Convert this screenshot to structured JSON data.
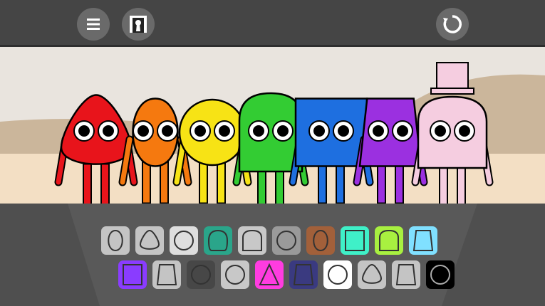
{
  "topbar": {
    "buttons": [
      {
        "icon": "menu-icon"
      },
      {
        "icon": "keyhole-portrait-icon"
      },
      {
        "icon": "reset-icon"
      }
    ]
  },
  "scene": {
    "sky_color": "#e9e4de",
    "ground_color": "#f3dfc4",
    "hill_color": "#cbb69b",
    "characters": [
      {
        "color": "#e8141b",
        "shape": "drop"
      },
      {
        "color": "#f5790f",
        "shape": "egg"
      },
      {
        "color": "#f7e315",
        "shape": "circle"
      },
      {
        "color": "#33cc33",
        "shape": "tombstone"
      },
      {
        "color": "#1e6fe0",
        "shape": "square"
      },
      {
        "color": "#9b30e0",
        "shape": "trapezoid"
      },
      {
        "color": "#f5cde0",
        "shape": "tombstone",
        "accessory": "top-hat"
      }
    ]
  },
  "palette": {
    "rows": [
      [
        {
          "color": "#c4c4c4",
          "shape": "egg"
        },
        {
          "color": "#c4c4c4",
          "shape": "drop"
        },
        {
          "color": "#dedede",
          "shape": "circle"
        },
        {
          "color": "#2aa58a",
          "shape": "blob"
        },
        {
          "color": "#c8c8c8",
          "shape": "tombstone"
        },
        {
          "color": "#9a9a9a",
          "shape": "circle"
        },
        {
          "color": "#a2603a",
          "shape": "egg"
        },
        {
          "color": "#3ff0c8",
          "shape": "square"
        },
        {
          "color": "#a8f040",
          "shape": "tombstone"
        },
        {
          "color": "#80e0ff",
          "shape": "trapezoid"
        }
      ],
      [
        {
          "color": "#8a3cff",
          "shape": "square"
        },
        {
          "color": "#c4c4c4",
          "shape": "trapezoid"
        },
        {
          "color": "#474747",
          "shape": "circle"
        },
        {
          "color": "#c8c8c8",
          "shape": "circle"
        },
        {
          "color": "#ff3ce0",
          "shape": "triangle"
        },
        {
          "color": "#3a3a80",
          "shape": "trapezoid"
        },
        {
          "color": "#ffffff",
          "shape": "circle"
        },
        {
          "color": "#c4c4c4",
          "shape": "drop"
        },
        {
          "color": "#c4c4c4",
          "shape": "trapezoid"
        },
        {
          "color": "#000000",
          "shape": "circle"
        }
      ]
    ]
  }
}
